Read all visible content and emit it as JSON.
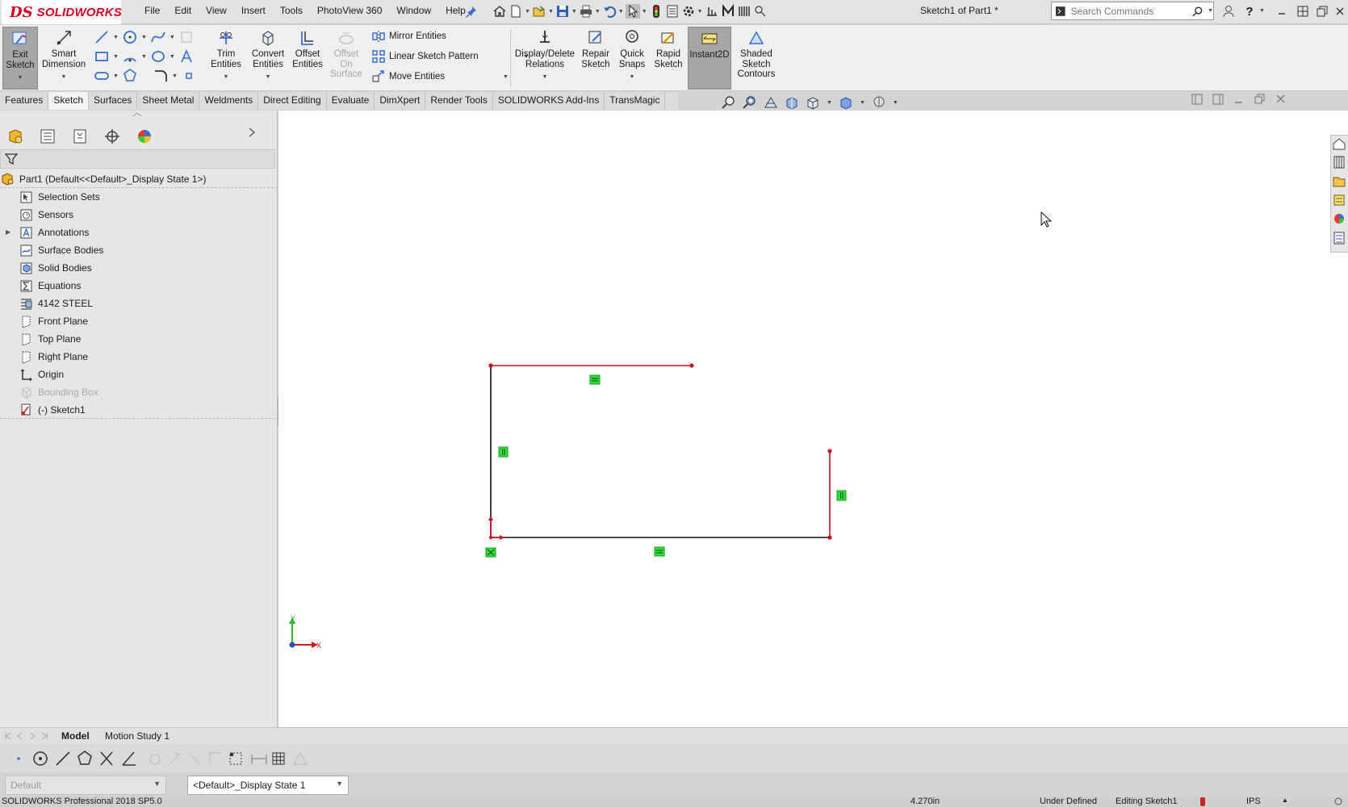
{
  "app": {
    "logo_prefix": "DS",
    "logo_text": "SOLIDWORKS",
    "doc_title": "Sketch1 of Part1 *"
  },
  "menu": [
    "File",
    "Edit",
    "View",
    "Insert",
    "Tools",
    "PhotoView 360",
    "Window",
    "Help"
  ],
  "search": {
    "placeholder": "Search Commands"
  },
  "ribbon": {
    "exit_sketch": "Exit Sketch",
    "smart_dimension": "Smart Dimension",
    "trim_entities": "Trim Entities",
    "convert_entities": "Convert Entities",
    "offset_entities": "Offset Entities",
    "offset_on_surface": "Offset On Surface",
    "mirror_entities": "Mirror Entities",
    "linear_sketch_pattern": "Linear Sketch Pattern",
    "move_entities": "Move Entities",
    "display_delete_relations": "Display/Delete Relations",
    "repair_sketch": "Repair Sketch",
    "quick_snaps": "Quick Snaps",
    "rapid_sketch": "Rapid Sketch",
    "instant2d": "Instant2D",
    "shaded_sketch_contours": "Shaded Sketch Contours"
  },
  "tabs": [
    "Features",
    "Sketch",
    "Surfaces",
    "Sheet Metal",
    "Weldments",
    "Direct Editing",
    "Evaluate",
    "DimXpert",
    "Render Tools",
    "SOLIDWORKS Add-Ins",
    "TransMagic"
  ],
  "active_tab": "Sketch",
  "tree": {
    "root": "Part1  (Default<<Default>_Display State 1>)",
    "items": [
      {
        "label": "Selection Sets",
        "icon": "selection-sets-icon"
      },
      {
        "label": "Sensors",
        "icon": "sensors-icon"
      },
      {
        "label": "Annotations",
        "icon": "annotations-icon"
      },
      {
        "label": "Surface Bodies",
        "icon": "surface-bodies-icon"
      },
      {
        "label": "Solid Bodies",
        "icon": "solid-bodies-icon"
      },
      {
        "label": "Equations",
        "icon": "equations-icon"
      },
      {
        "label": "4142 STEEL",
        "icon": "material-icon"
      },
      {
        "label": "Front Plane",
        "icon": "plane-icon"
      },
      {
        "label": "Top Plane",
        "icon": "plane-icon"
      },
      {
        "label": "Right Plane",
        "icon": "plane-icon"
      },
      {
        "label": "Origin",
        "icon": "origin-icon"
      },
      {
        "label": "Bounding Box",
        "icon": "bounding-box-icon"
      },
      {
        "label": "(-) Sketch1",
        "icon": "sketch-icon"
      }
    ]
  },
  "triad": {
    "x_label": "X",
    "y_label": "Y"
  },
  "bottom_tabs": {
    "model": "Model",
    "motion": "Motion Study 1"
  },
  "config_select": "Default",
  "display_state_select": "<Default>_Display State 1",
  "status": {
    "product": "SOLIDWORKS Professional 2018 SP5.0",
    "coord": "4.270in",
    "state": "Under Defined",
    "editing": "Editing Sketch1",
    "units": "IPS"
  },
  "colors": {
    "accent_red": "#d8001f",
    "relation_green": "#2fdc3a",
    "sketch_red": "#cc1022"
  }
}
